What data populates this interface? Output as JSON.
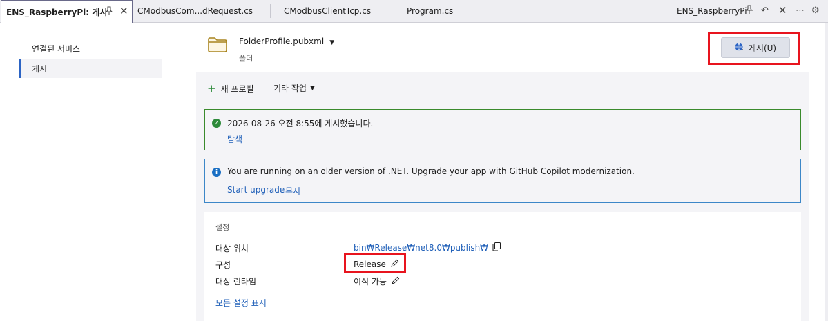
{
  "tabs": {
    "active": {
      "title": "ENS_RaspberryPi: 게시",
      "pin_icon": "pin-icon",
      "close_icon": "close-icon"
    },
    "others": [
      "CModbusCom...dRequest.cs",
      "CModbusClientTcp.cs",
      "Program.cs"
    ],
    "right_title": "ENS_RaspberryPi"
  },
  "toolbar_icons": [
    "pin-icon",
    "back-arrow-icon",
    "close-icon",
    "more-icon",
    "gear-icon"
  ],
  "sidebar": {
    "items": [
      {
        "label": "연결된 서비스",
        "selected": false
      },
      {
        "label": "게시",
        "selected": true
      }
    ]
  },
  "profile": {
    "name": "FolderProfile.pubxml",
    "kind": "폴더",
    "publish_button": "게시(U)"
  },
  "actions": {
    "new_profile": "새 프로필",
    "more_actions": "기타 작업"
  },
  "success": {
    "message": "2026-08-26 오전 8:55에 게시했습니다.",
    "link": "탐색"
  },
  "info": {
    "message": "You are running on an older version of .NET. Upgrade your app with GitHub Copilot modernization.",
    "start_upgrade": "Start upgrade",
    "ignore": "무시"
  },
  "settings": {
    "title": "설정",
    "target_location_label": "대상 위치",
    "target_location_value": "bin₩Release₩net8.0₩publish₩",
    "configuration_label": "구성",
    "configuration_value": "Release",
    "runtime_label": "대상 런타임",
    "runtime_value": "이식 가능",
    "show_all": "모든 설정 표시"
  },
  "colors": {
    "accent_blue": "#1f5fb8",
    "success_green": "#2d8a3a",
    "highlight_red": "#e8141e",
    "info_blue": "#1a6fc4"
  }
}
